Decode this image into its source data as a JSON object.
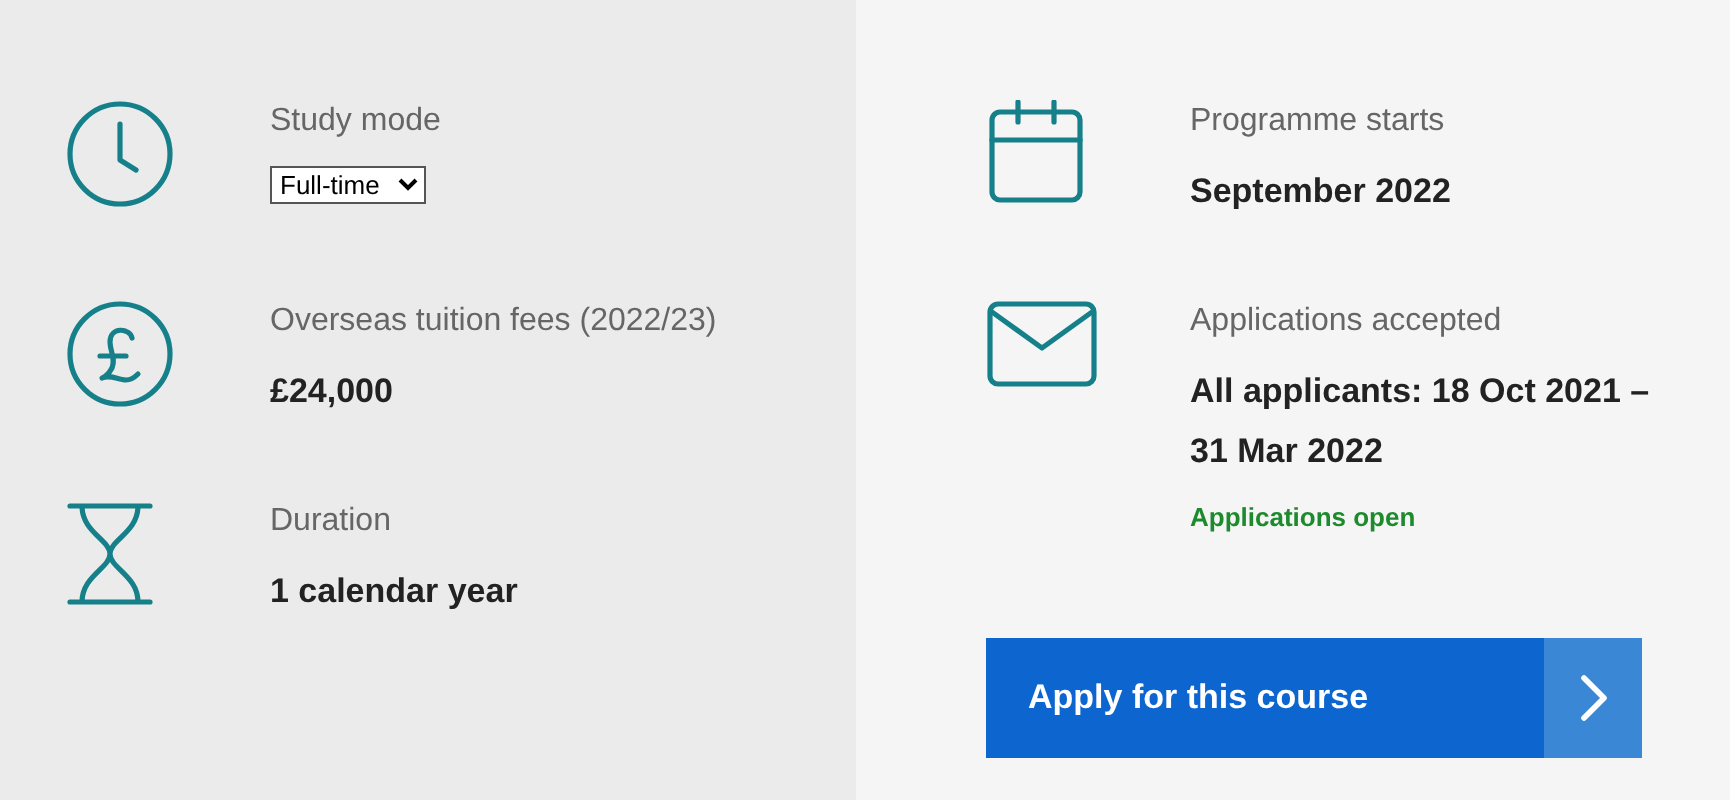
{
  "left": [
    {
      "label": "Study mode",
      "kind": "select",
      "value": "Full-time"
    },
    {
      "label": "Overseas tuition fees (2022/23)",
      "kind": "text",
      "value": "£24,000"
    },
    {
      "label": "Duration",
      "kind": "text",
      "value": "1 calendar year"
    }
  ],
  "right": [
    {
      "label": "Programme starts",
      "value": "September 2022"
    },
    {
      "label": "Applications accepted",
      "value": "All applicants: 18 Oct 2021 – 31 Mar 2022",
      "status": "Applications open"
    }
  ],
  "apply_button": {
    "label": "Apply for this course"
  }
}
